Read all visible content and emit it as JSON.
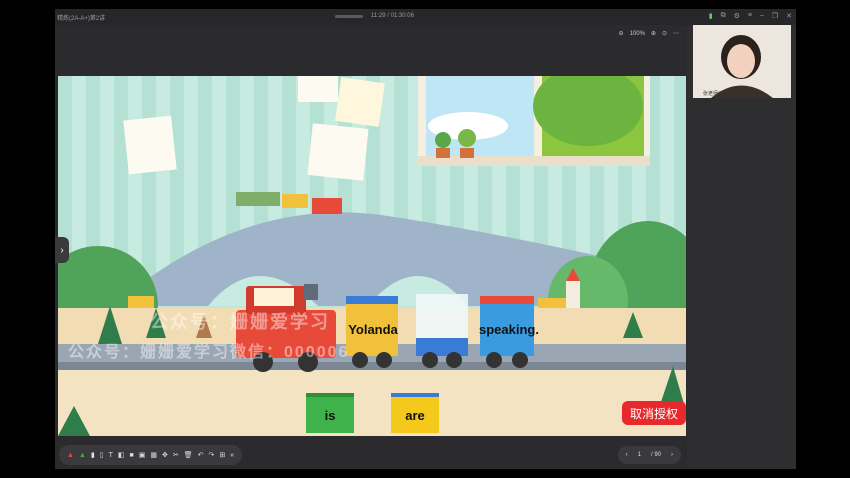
{
  "window": {
    "title": "精炼(2A-A+)第2讲",
    "elapsed": "11:29 / 01:30:06",
    "controls": [
      "signal-icon",
      "share-icon",
      "settings-icon",
      "menu-icon",
      "minimize-icon",
      "restore-icon",
      "close-icon"
    ]
  },
  "view": {
    "zoom_label": "100%"
  },
  "scene": {
    "sentence_words": [
      "Yolanda",
      "",
      "speaking."
    ],
    "choice_cards": [
      {
        "label": "is",
        "color": "#3fb24a"
      },
      {
        "label": "are",
        "color": "#f5c91c"
      }
    ],
    "cancel_button": "取消授权",
    "watermark_line1": "公众号：姗姗爱学习",
    "watermark_line2": "公众号：姗姗爱学习微信：000006"
  },
  "camera": {
    "name_label": "张老师(老师)"
  },
  "pager": {
    "current": "1",
    "total": "/ 90"
  },
  "colors": {
    "accent_red": "#e8292c",
    "card_green": "#3fb24a",
    "card_yellow": "#f5c91c",
    "window_bg": "#2b2b2e"
  }
}
